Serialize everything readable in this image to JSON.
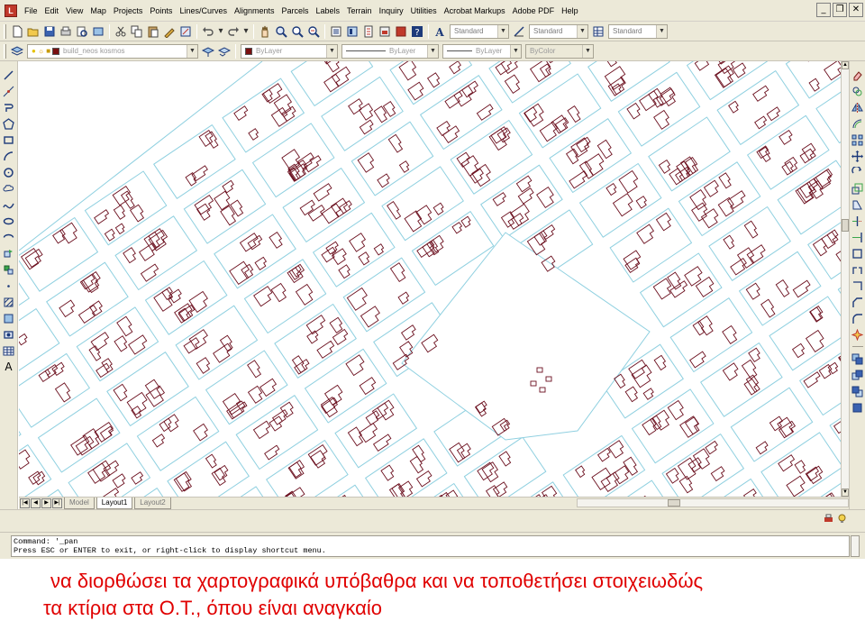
{
  "menu": {
    "items": [
      "File",
      "Edit",
      "View",
      "Map",
      "Projects",
      "Points",
      "Lines/Curves",
      "Alignments",
      "Parcels",
      "Labels",
      "Terrain",
      "Inquiry",
      "Utilities",
      "Acrobat Markups",
      "Adobe PDF",
      "Help"
    ]
  },
  "window_controls": {
    "minimize": "_",
    "restore": "❐",
    "close": "✕"
  },
  "toolbar": {
    "text_style": "Standard",
    "dim_style": "Standard",
    "table_style": "Standard",
    "layer": "build_neos kosmos",
    "color": "ByLayer",
    "color_swatch": "#7a1010",
    "linetype": "ByLayer",
    "lineweight": "ByLayer",
    "plotstyle": "ByColor"
  },
  "tabs": {
    "model": "Model",
    "layout1": "Layout1",
    "layout2": "Layout2"
  },
  "command": {
    "line1": "Command: '_pan",
    "line2": "Press ESC or ENTER to exit, or right-click to display shortcut menu."
  },
  "caption": {
    "line1": "να διορθώσει τα χαρτογραφικά υπόβαθρα και να τοποθετήσει στοιχειωδώς",
    "line2": "τα κτίρια στα Ο.Τ., όπου είναι αναγκαίο"
  },
  "colors": {
    "street_lines": "#8fd0e0",
    "buildings": "#6b0f1e",
    "caption_text": "#e00000"
  }
}
